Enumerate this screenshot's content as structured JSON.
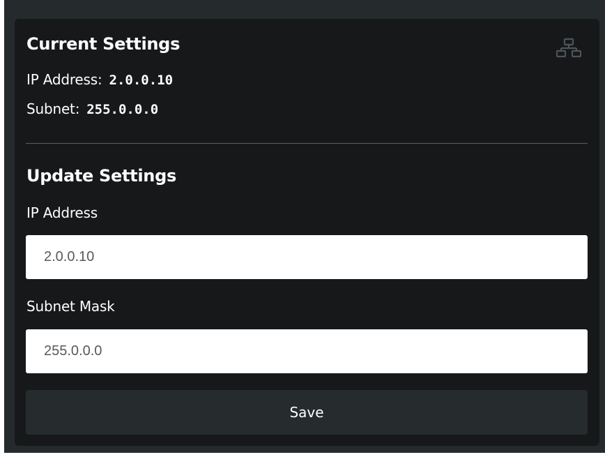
{
  "current": {
    "title": "Current Settings",
    "ip_label": "IP Address:",
    "ip_value": "2.0.0.10",
    "subnet_label": "Subnet:",
    "subnet_value": "255.0.0.0",
    "icon": "network-icon"
  },
  "update": {
    "title": "Update Settings",
    "ip_label": "IP Address",
    "ip_value": "2.0.0.10",
    "mask_label": "Subnet Mask",
    "mask_value": "255.0.0.0",
    "save_label": "Save"
  },
  "colors": {
    "page_bg": "#252a2d",
    "card_bg": "#17181a",
    "button_bg": "#262b2e",
    "divider": "#5a5f63",
    "input_text": "#555a5e",
    "text": "#ffffff"
  }
}
